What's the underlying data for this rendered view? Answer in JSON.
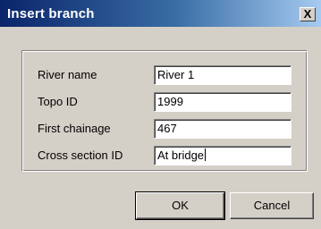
{
  "window": {
    "title": "Insert branch",
    "close_label": "X"
  },
  "form": {
    "fields": [
      {
        "label": "River name",
        "value": "River 1"
      },
      {
        "label": "Topo ID",
        "value": "1999"
      },
      {
        "label": "First chainage",
        "value": "467"
      },
      {
        "label": "Cross section ID",
        "value": "At bridge"
      }
    ]
  },
  "buttons": {
    "ok_label": "OK",
    "cancel_label": "Cancel"
  }
}
